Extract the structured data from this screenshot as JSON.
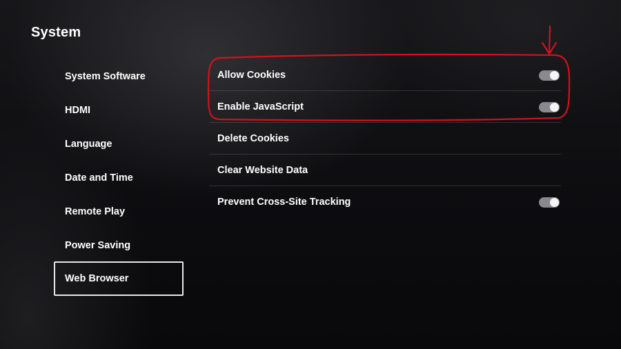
{
  "header": {
    "title": "System"
  },
  "sidebar": {
    "items": [
      {
        "label": "System Software"
      },
      {
        "label": "HDMI"
      },
      {
        "label": "Language"
      },
      {
        "label": "Date and Time"
      },
      {
        "label": "Remote Play"
      },
      {
        "label": "Power Saving"
      },
      {
        "label": "Web Browser",
        "selected": true
      }
    ]
  },
  "settings": {
    "rows": [
      {
        "label": "Allow Cookies",
        "control": "toggle",
        "on": true
      },
      {
        "label": "Enable JavaScript",
        "control": "toggle",
        "on": true
      },
      {
        "label": "Delete Cookies"
      },
      {
        "label": "Clear Website Data"
      },
      {
        "label": "Prevent Cross-Site Tracking",
        "control": "toggle",
        "on": true
      }
    ]
  },
  "colors": {
    "annotation": "#d4101e",
    "toggle_track": "#8a8a8e",
    "selected_border": "#e8e8e8"
  }
}
